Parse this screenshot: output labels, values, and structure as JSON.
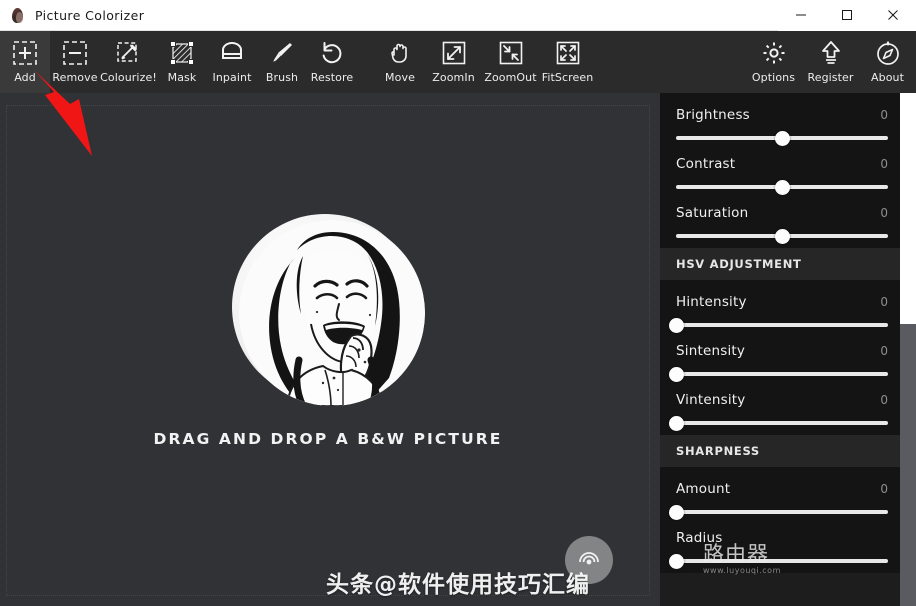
{
  "window": {
    "title": "Picture Colorizer",
    "icon": "app-logo-icon",
    "minimize_label": "—",
    "maximize_label": "□",
    "close_label": "✕"
  },
  "toolbar": {
    "left_items": [
      {
        "label": "Add",
        "icon": "add-dashed-plus-icon"
      },
      {
        "label": "Remove",
        "icon": "remove-dashed-minus-icon"
      },
      {
        "label": "Colourize!",
        "icon": "eyedropper-dashed-icon"
      },
      {
        "label": "Mask",
        "icon": "mask-hatched-square-icon"
      },
      {
        "label": "Inpaint",
        "icon": "inpaint-bandage-icon"
      },
      {
        "label": "Brush",
        "icon": "brush-icon"
      },
      {
        "label": "Restore",
        "icon": "restore-undo-arrow-icon"
      }
    ],
    "middle_items": [
      {
        "label": "Move",
        "icon": "hand-move-icon"
      },
      {
        "label": "ZoomIn",
        "icon": "zoom-in-icon"
      },
      {
        "label": "ZoomOut",
        "icon": "zoom-out-icon"
      },
      {
        "label": "FitScreen",
        "icon": "fit-screen-icon"
      }
    ],
    "right_items": [
      {
        "label": "Options",
        "icon": "gear-icon"
      },
      {
        "label": "Register",
        "icon": "upload-arrow-icon"
      },
      {
        "label": "About",
        "icon": "compass-icon"
      }
    ]
  },
  "canvas": {
    "drop_caption": "DRAG AND DROP A B&W PICTURE",
    "placeholder_image": "circular-bw-portrait-illustration"
  },
  "sidebar": {
    "basic_sliders": [
      {
        "label": "Brightness",
        "value": "0",
        "percent": 50
      },
      {
        "label": "Contrast",
        "value": "0",
        "percent": 50
      },
      {
        "label": "Saturation",
        "value": "0",
        "percent": 50
      }
    ],
    "sections": [
      {
        "heading": "HSV ADJUSTMENT",
        "sliders": [
          {
            "label": "Hintensity",
            "value": "0",
            "percent": 0
          },
          {
            "label": "Sintensity",
            "value": "0",
            "percent": 0
          },
          {
            "label": "Vintensity",
            "value": "0",
            "percent": 0
          }
        ]
      },
      {
        "heading": "SHARPNESS",
        "sliders": [
          {
            "label": "Amount",
            "value": "0",
            "percent": 0
          },
          {
            "label": "Radius",
            "value": "",
            "percent": 0
          }
        ]
      }
    ]
  },
  "annotation": {
    "arrow": "red-pointer-arrow-to-add-button",
    "color": "#f01616"
  },
  "watermark": {
    "main_text": "头条@软件使用技巧汇编",
    "logo_text": "路由器",
    "logo_sub": "www.luyouqi.com",
    "logo_icon": "router-signal-icon"
  },
  "colors": {
    "titlebar_bg": "#ffffff",
    "toolbar_bg": "#2b2b2b",
    "canvas_bg": "#313236",
    "sidebar_bg": "#1d1d1d",
    "panel_bg": "#141414",
    "section_bg": "#262626",
    "accent_red": "#f01616",
    "slider_track": "#e8e8e8"
  }
}
